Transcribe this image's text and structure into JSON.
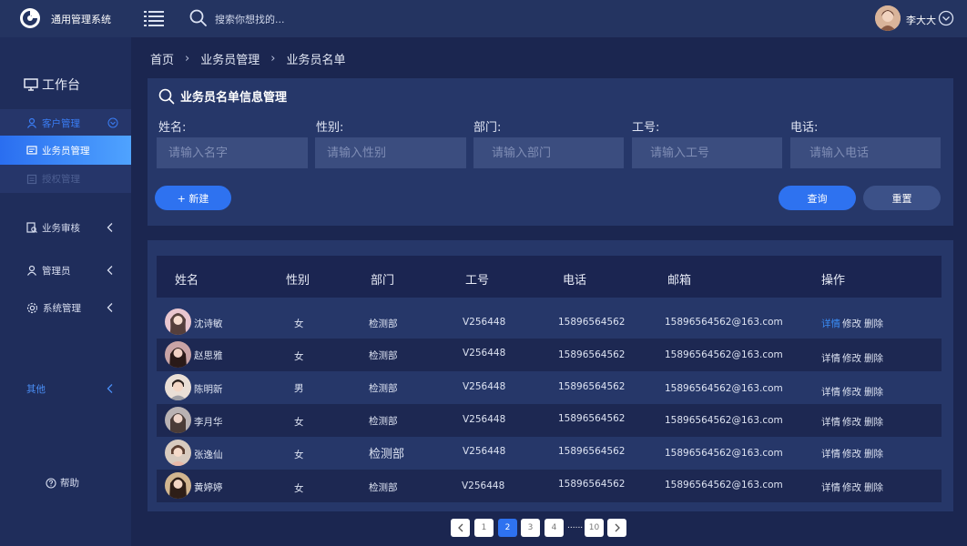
{
  "app": {
    "title": "通用管理系统"
  },
  "topbar": {
    "search_placeholder": "搜索你想找的...",
    "username": "李大大"
  },
  "sidebar": {
    "workbench": "工作台",
    "items": [
      {
        "label": "客户管理"
      },
      {
        "label": "业务员管理"
      },
      {
        "label": "授权管理"
      },
      {
        "label": "业务审核"
      },
      {
        "label": "管理员"
      },
      {
        "label": "系统管理"
      },
      {
        "label": "其他"
      }
    ],
    "help": "帮助"
  },
  "breadcrumb": [
    "首页",
    "业务员管理",
    "业务员名单"
  ],
  "filter": {
    "title": "业务员名单信息管理",
    "fields": [
      {
        "label": "姓名:",
        "placeholder": "请输入名字"
      },
      {
        "label": "性别:",
        "placeholder": "请输入性别"
      },
      {
        "label": "部门:",
        "placeholder": "请输入部门"
      },
      {
        "label": "工号:",
        "placeholder": "请输入工号"
      },
      {
        "label": "电话:",
        "placeholder": "请输入电话"
      }
    ],
    "new_button": "+ 新建",
    "query_button": "查询",
    "reset_button": "重置"
  },
  "table": {
    "headers": [
      "姓名",
      "性别",
      "部门",
      "工号",
      "电话",
      "邮箱",
      "操作"
    ],
    "actions": {
      "detail": "详情",
      "edit": "修改",
      "delete": "删除"
    },
    "rows": [
      {
        "name": "沈诗敏",
        "gender": "女",
        "dept": "检测部",
        "id": "V256448",
        "phone": "15896564562",
        "email": "15896564562@163.com"
      },
      {
        "name": "赵思雅",
        "gender": "女",
        "dept": "检测部",
        "id": "V256448",
        "phone": "15896564562",
        "email": "15896564562@163.com"
      },
      {
        "name": "陈明新",
        "gender": "男",
        "dept": "检测部",
        "id": "V256448",
        "phone": "15896564562",
        "email": "15896564562@163.com"
      },
      {
        "name": "李月华",
        "gender": "女",
        "dept": "检测部",
        "id": "V256448",
        "phone": "15896564562",
        "email": "15896564562@163.com"
      },
      {
        "name": "张逸仙",
        "gender": "女",
        "dept": "检测部",
        "id": "V256448",
        "phone": "15896564562",
        "email": "15896564562@163.com"
      },
      {
        "name": "黄婷婷",
        "gender": "女",
        "dept": "检测部",
        "id": "V256448",
        "phone": "15896564562",
        "email": "15896564562@163.com"
      }
    ]
  },
  "pagination": {
    "pages": [
      "1",
      "2",
      "3",
      "4",
      "10"
    ],
    "current": "2",
    "ellipsis": "......"
  },
  "colors": {
    "accent": "#2e72f0",
    "link": "#3a8cf6",
    "background": "#1b2650",
    "panel": "#263769"
  }
}
